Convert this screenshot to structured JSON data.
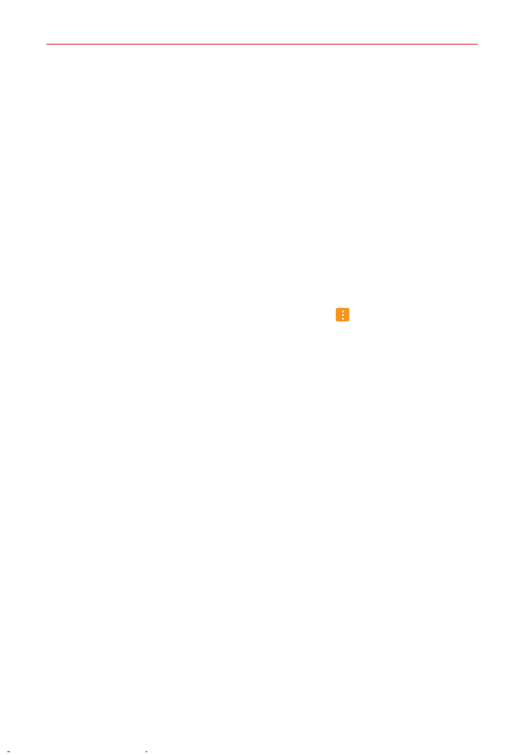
{
  "colors": {
    "header_rule": "#d32f2f",
    "menu_icon_bg": "#f7941d",
    "menu_icon_fg": "#ffffff",
    "background": "#ffffff"
  },
  "icons": {
    "overflow_menu": "more-vert-icon"
  }
}
